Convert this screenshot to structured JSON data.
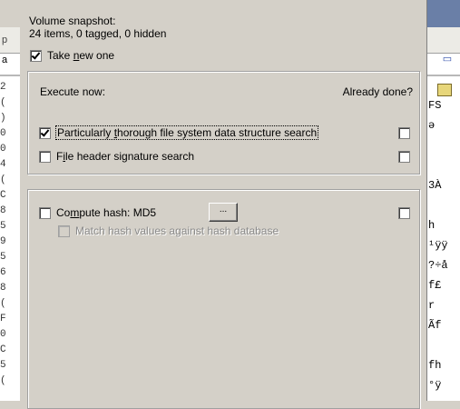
{
  "background_left": {
    "menu_fragment": "p",
    "toolbar_glyph": "a",
    "lines": [
      "2",
      "(",
      ")",
      "0",
      "0",
      "4",
      "(",
      "C",
      "8",
      "5",
      "9",
      "5",
      "6",
      "8",
      "(",
      "F",
      "0",
      "C",
      "5",
      "("
    ]
  },
  "background_right": {
    "menu_fragment": "",
    "lines": [
      "FS",
      "ə",
      "",
      "",
      "3À",
      "",
      "h",
      "¹ÿÿ",
      "?÷å",
      "f£",
      "r",
      "Ãf",
      "",
      "fh",
      "°ÿ"
    ]
  },
  "snapshot": {
    "title": "Volume snapshot:",
    "info": "24 items, 0 tagged, 0 hidden",
    "take_new": {
      "pre": "Take ",
      "ul": "n",
      "post": "ew one",
      "checked": true
    }
  },
  "execute_group": {
    "execute_now": "Execute now:",
    "already_done": "Already done?",
    "thorough_search": {
      "pre": "Particularly ",
      "ul": "t",
      "post": "horough file system data structure search",
      "checked": true,
      "done": false
    },
    "header_search": {
      "pre": "F",
      "ul": "i",
      "post": "le header signature search",
      "checked": false,
      "done": false
    }
  },
  "hash_group": {
    "compute_hash": {
      "pre": "Co",
      "ul": "m",
      "post": "pute hash: MD5",
      "checked": false,
      "done": false
    },
    "hash_button_label": "...",
    "match_hash": {
      "label": "Match hash values against hash database",
      "checked": false,
      "enabled": false
    }
  }
}
